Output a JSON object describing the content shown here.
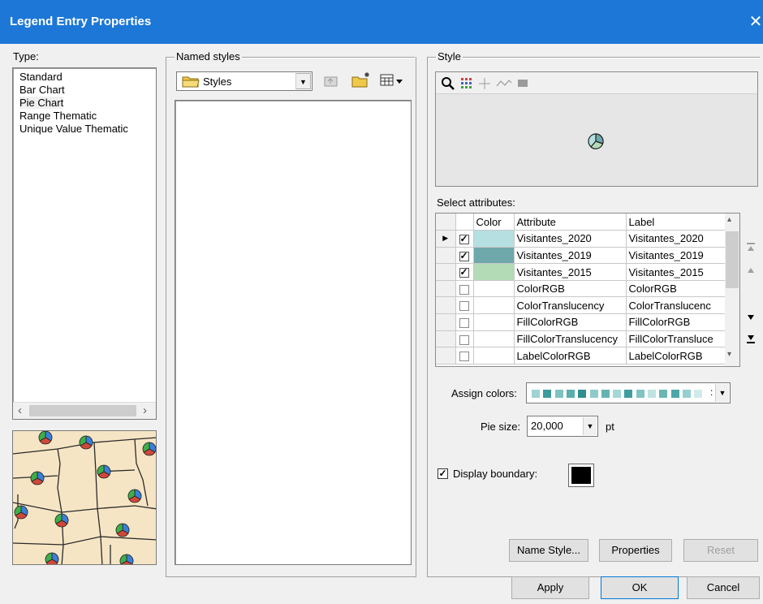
{
  "window": {
    "title": "Legend Entry Properties",
    "close_glyph": "✕"
  },
  "type_group": {
    "label": "Type:",
    "items": [
      "Standard",
      "Bar Chart",
      "Pie Chart",
      "Range Thematic",
      "Unique Value Thematic"
    ],
    "selected": "Pie Chart"
  },
  "named_styles": {
    "label": "Named styles",
    "combo_value": "Styles"
  },
  "style_group": {
    "label": "Style"
  },
  "select_attributes": {
    "label": "Select attributes:",
    "columns": [
      "Color",
      "Attribute",
      "Label"
    ],
    "rows": [
      {
        "checked": true,
        "color": "#b5dfe0",
        "attribute": "Visitantes_2020",
        "label": "Visitantes_2020",
        "current": true
      },
      {
        "checked": true,
        "color": "#6fa8aa",
        "attribute": "Visitantes_2019",
        "label": "Visitantes_2019",
        "current": false
      },
      {
        "checked": true,
        "color": "#b3dbb6",
        "attribute": "Visitantes_2015",
        "label": "Visitantes_2015",
        "current": false
      },
      {
        "checked": false,
        "color": "",
        "attribute": "ColorRGB",
        "label": "ColorRGB",
        "current": false
      },
      {
        "checked": false,
        "color": "",
        "attribute": "ColorTranslucency",
        "label": "ColorTranslucenc",
        "current": false
      },
      {
        "checked": false,
        "color": "",
        "attribute": "FillColorRGB",
        "label": "FillColorRGB",
        "current": false
      },
      {
        "checked": false,
        "color": "",
        "attribute": "FillColorTranslucency",
        "label": "FillColorTransluce",
        "current": false
      },
      {
        "checked": false,
        "color": "",
        "attribute": "LabelColorRGB",
        "label": "LabelColorRGB",
        "current": false
      }
    ]
  },
  "assign_colors": {
    "label": "Assign colors:",
    "swatches": [
      "#9fd3d3",
      "#3c9a9c",
      "#7ec3c2",
      "#5aaeae",
      "#2f8f90",
      "#8fcacb",
      "#64b3b3",
      "#a4d7d7",
      "#3f9d9e",
      "#80c4c4",
      "#bfe3e2",
      "#6ab6b5",
      "#4ea7a7",
      "#96cfcf",
      "#d0ebea"
    ]
  },
  "pie_size": {
    "label": "Pie size:",
    "value": "20,000",
    "unit": "pt"
  },
  "display_boundary": {
    "label": "Display boundary:",
    "checked": true
  },
  "buttons": {
    "name_style": "Name Style...",
    "properties": "Properties",
    "reset": "Reset",
    "apply": "Apply",
    "ok": "OK",
    "cancel": "Cancel"
  },
  "icons": {
    "zoom": "magnifier-icon",
    "grid": "grid-icon",
    "crosshair": "crosshair-icon",
    "line": "line-icon",
    "fill": "fill-icon"
  }
}
